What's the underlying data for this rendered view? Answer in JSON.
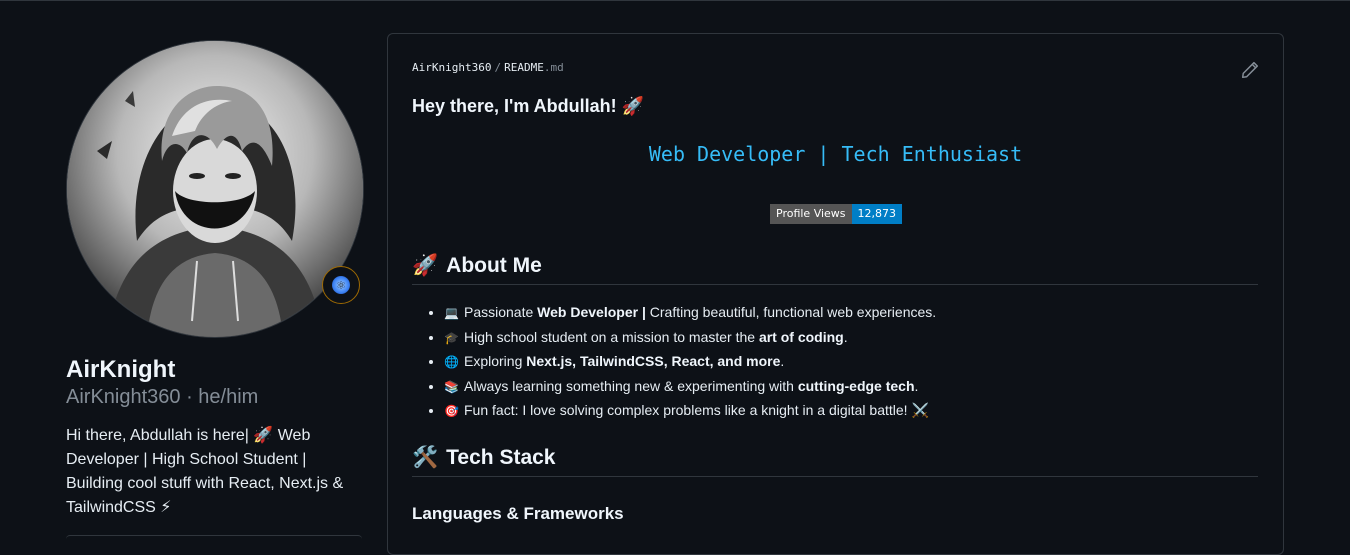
{
  "profile": {
    "display_name": "AirKnight",
    "username_line": "AirKnight360 · he/him",
    "bio_lines": [
      "Hi there, Abdullah is here| 🚀 Web",
      "Developer | High School Student |",
      "Building cool stuff with React, Next.js &",
      "TailwindCSS ⚡"
    ],
    "status_emoji": "react-atom-icon"
  },
  "readme": {
    "owner": "AirKnight360",
    "separator": "/",
    "file_name": "README",
    "file_ext": ".md",
    "greeting": "Hey there, I'm Abdullah! 🚀",
    "typing_text": "Web Developer | Tech Enthusiast",
    "views_label": "Profile Views",
    "views_count": "12,873",
    "about_heading": "About Me",
    "about_emoji": "🚀",
    "about_items": [
      {
        "emoji": "💻",
        "pre": "Passionate ",
        "bold": "Web Developer |",
        "post": " Crafting beautiful, functional web experiences."
      },
      {
        "emoji": "🎓",
        "pre": "High school student on a mission to master the ",
        "bold": "art of coding",
        "post": "."
      },
      {
        "emoji": "🌐",
        "pre": "Exploring ",
        "bold": "Next.js, TailwindCSS, React, and more",
        "post": "."
      },
      {
        "emoji": "📚",
        "pre": "Always learning something new & experimenting with ",
        "bold": "cutting-edge tech",
        "post": "."
      },
      {
        "emoji": "🎯",
        "pre": "Fun fact: I love solving complex problems like a knight in a digital battle! ",
        "bold": "",
        "post": "⚔️"
      }
    ],
    "stack_heading": "Tech Stack",
    "stack_emoji": "🛠️",
    "languages_heading": "Languages & Frameworks"
  },
  "colors": {
    "background": "#0d1117",
    "border": "#30363d",
    "muted": "#848d97",
    "typing": "#36bcf7",
    "badge_value": "#007ec6"
  }
}
